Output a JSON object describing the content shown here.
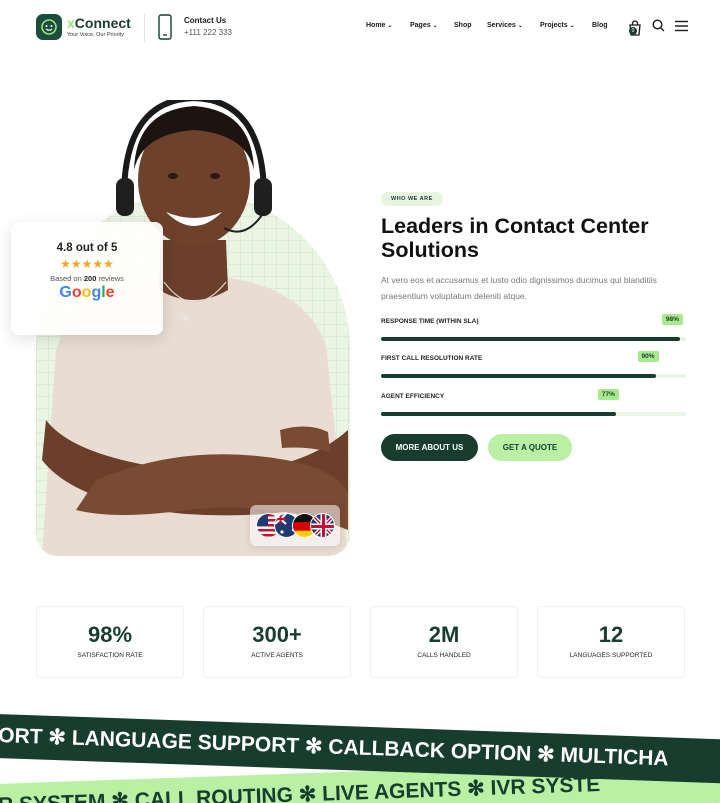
{
  "header": {
    "logo_x": "x",
    "logo_name": "Connect",
    "logo_tagline": "Your Voice, Our Priority",
    "contact_title": "Contact Us",
    "contact_phone": "+111 222 333",
    "nav": [
      {
        "label": "Home",
        "has_dropdown": true
      },
      {
        "label": "Pages",
        "has_dropdown": true
      },
      {
        "label": "Shop",
        "has_dropdown": false
      },
      {
        "label": "Services",
        "has_dropdown": true
      },
      {
        "label": "Projects",
        "has_dropdown": true
      },
      {
        "label": "Blog",
        "has_dropdown": false
      }
    ],
    "cart_count": "0"
  },
  "rating_card": {
    "title": "4.8 out of 5",
    "stars": "★★★★★",
    "based_on_prefix": "Based on",
    "review_count": "200",
    "based_on_suffix": "reviews",
    "brand": "Google"
  },
  "hero": {
    "tag": "WHO WE ARE",
    "headline": "Leaders in Contact Center Solutions",
    "lead": "At vero eos et accusamus et iusto odio dignissimos ducimus qui blanditiis praesentium voluptatum deleniti atque.",
    "metrics": [
      {
        "label": "RESPONSE TIME (WITHIN SLA)",
        "value_text": "98%",
        "fraction": 0.98
      },
      {
        "label": "FIRST CALL RESOLUTION RATE",
        "value_text": "90%",
        "fraction": 0.9
      },
      {
        "label": "AGENT EFFICIENCY",
        "value_text": "77%",
        "fraction": 0.77
      }
    ],
    "primary_button": "MORE ABOUT US",
    "secondary_button": "GET A QUOTE"
  },
  "stats": [
    {
      "value": "98%",
      "label": "SATISFACTION RATE"
    },
    {
      "value": "300+",
      "label": "ACTIVE AGENTS"
    },
    {
      "value": "2M",
      "label": "CALLS HANDLED"
    },
    {
      "value": "12",
      "label": "LANGUAGES SUPPORTED"
    }
  ],
  "ribbons": {
    "dark_text": "ORT  ✻  LANGUAGE SUPPORT  ✻  CALLBACK OPTION  ✻  MULTICHA",
    "light_text": "R SYSTEM  ✻  CALL ROUTING  ✻  LIVE AGENTS  ✻  IVR SYSTE"
  },
  "colors": {
    "brand_dark": "#173d2f",
    "brand_light": "#b9f0a3",
    "star": "#f5a623"
  }
}
